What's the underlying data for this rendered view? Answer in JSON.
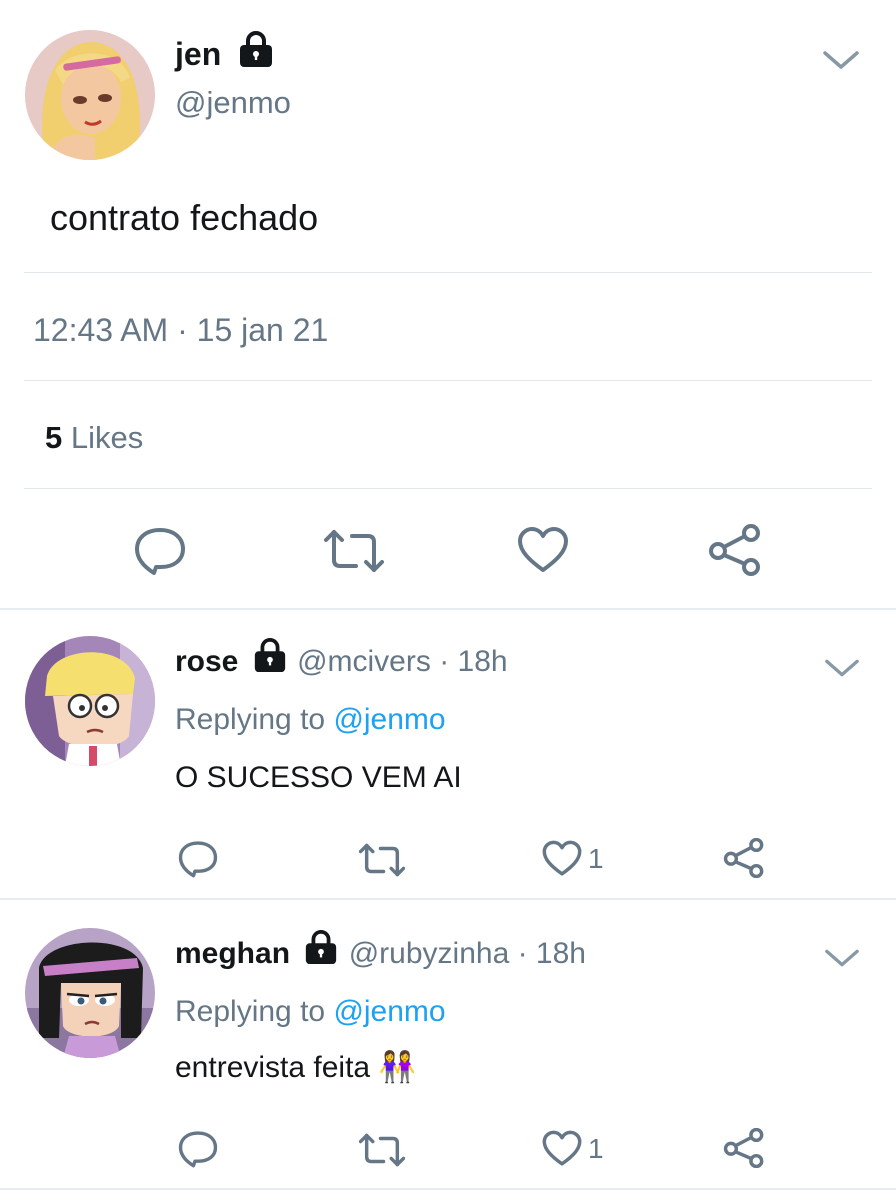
{
  "main_tweet": {
    "name": "jen",
    "handle": "@jenmo",
    "text": "contrato fechado",
    "timestamp": "12:43 AM · 15 jan 21",
    "likes_count": "5",
    "likes_label": "Likes"
  },
  "replies": [
    {
      "name": "rose",
      "handle": "@mcivers",
      "time": "· 18h",
      "replying_prefix": "Replying to",
      "replying_to": "@jenmo",
      "text": "O SUCESSO VEM AI",
      "like_count": "1"
    },
    {
      "name": "meghan",
      "handle": "@rubyzinha",
      "time": "· 18h",
      "replying_prefix": "Replying to",
      "replying_to": "@jenmo",
      "text": "entrevista feita 👭",
      "like_count": "1"
    }
  ],
  "icons": {
    "lock": "lock-icon",
    "chevron": "chevron-down-icon",
    "reply": "reply-icon",
    "retweet": "retweet-icon",
    "like": "heart-icon",
    "share": "share-icon"
  },
  "colors": {
    "text": "#14171a",
    "secondary": "#657786",
    "link": "#1da1f2",
    "divider": "#e1e8ed"
  }
}
